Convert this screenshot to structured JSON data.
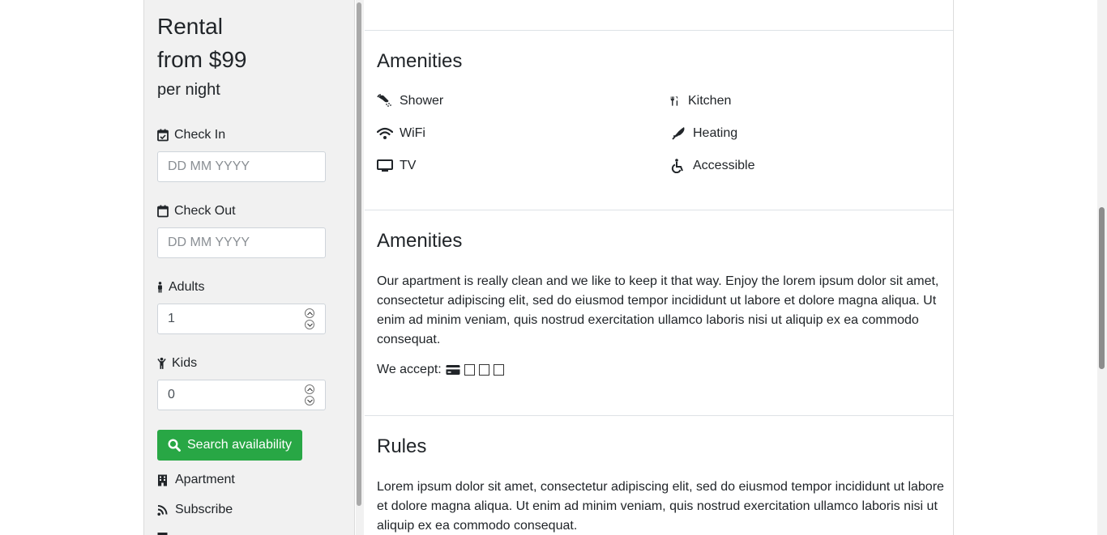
{
  "booking": {
    "title_line1": "Rental",
    "title_line2": "from $99",
    "title_line3": "per night",
    "check_in": {
      "label": "Check In",
      "placeholder": "DD MM YYYY",
      "icon": "calendar-check-icon"
    },
    "check_out": {
      "label": "Check Out",
      "placeholder": "DD MM YYYY",
      "icon": "calendar-icon"
    },
    "adults": {
      "label": "Adults",
      "value": "1",
      "icon": "person-icon"
    },
    "kids": {
      "label": "Kids",
      "value": "0",
      "icon": "child-icon"
    },
    "search_button": "Search availability",
    "links": [
      {
        "label": "Apartment",
        "icon": "building-icon"
      },
      {
        "label": "Subscribe",
        "icon": "rss-icon"
      }
    ]
  },
  "main": {
    "amenities_icons": {
      "title": "Amenities",
      "items": [
        {
          "label": "Shower",
          "icon": "shower-icon"
        },
        {
          "label": "Kitchen",
          "icon": "utensils-icon"
        },
        {
          "label": "WiFi",
          "icon": "wifi-icon"
        },
        {
          "label": "Heating",
          "icon": "feather-icon"
        },
        {
          "label": "TV",
          "icon": "tv-icon"
        },
        {
          "label": "Accessible",
          "icon": "wheelchair-icon"
        }
      ]
    },
    "amenities_text": {
      "title": "Amenities",
      "paragraph": "Our apartment is really clean and we like to keep it that way. Enjoy the lorem ipsum dolor sit amet, consectetur adipiscing elit, sed do eiusmod tempor incididunt ut labore et dolore magna aliqua. Ut enim ad minim veniam, quis nostrud exercitation ullamco laboris nisi ut aliquip ex ea commodo consequat.",
      "accept_label": "We accept:"
    },
    "rules": {
      "title": "Rules",
      "paragraph": "Lorem ipsum dolor sit amet, consectetur adipiscing elit, sed do eiusmod tempor incididunt ut labore et dolore magna aliqua. Ut enim ad minim veniam, quis nostrud exercitation ullamco laboris nisi ut aliquip ex ea commodo consequat."
    }
  },
  "colors": {
    "accent": "#28a745",
    "sidebar_bg": "#f1f1f1"
  }
}
